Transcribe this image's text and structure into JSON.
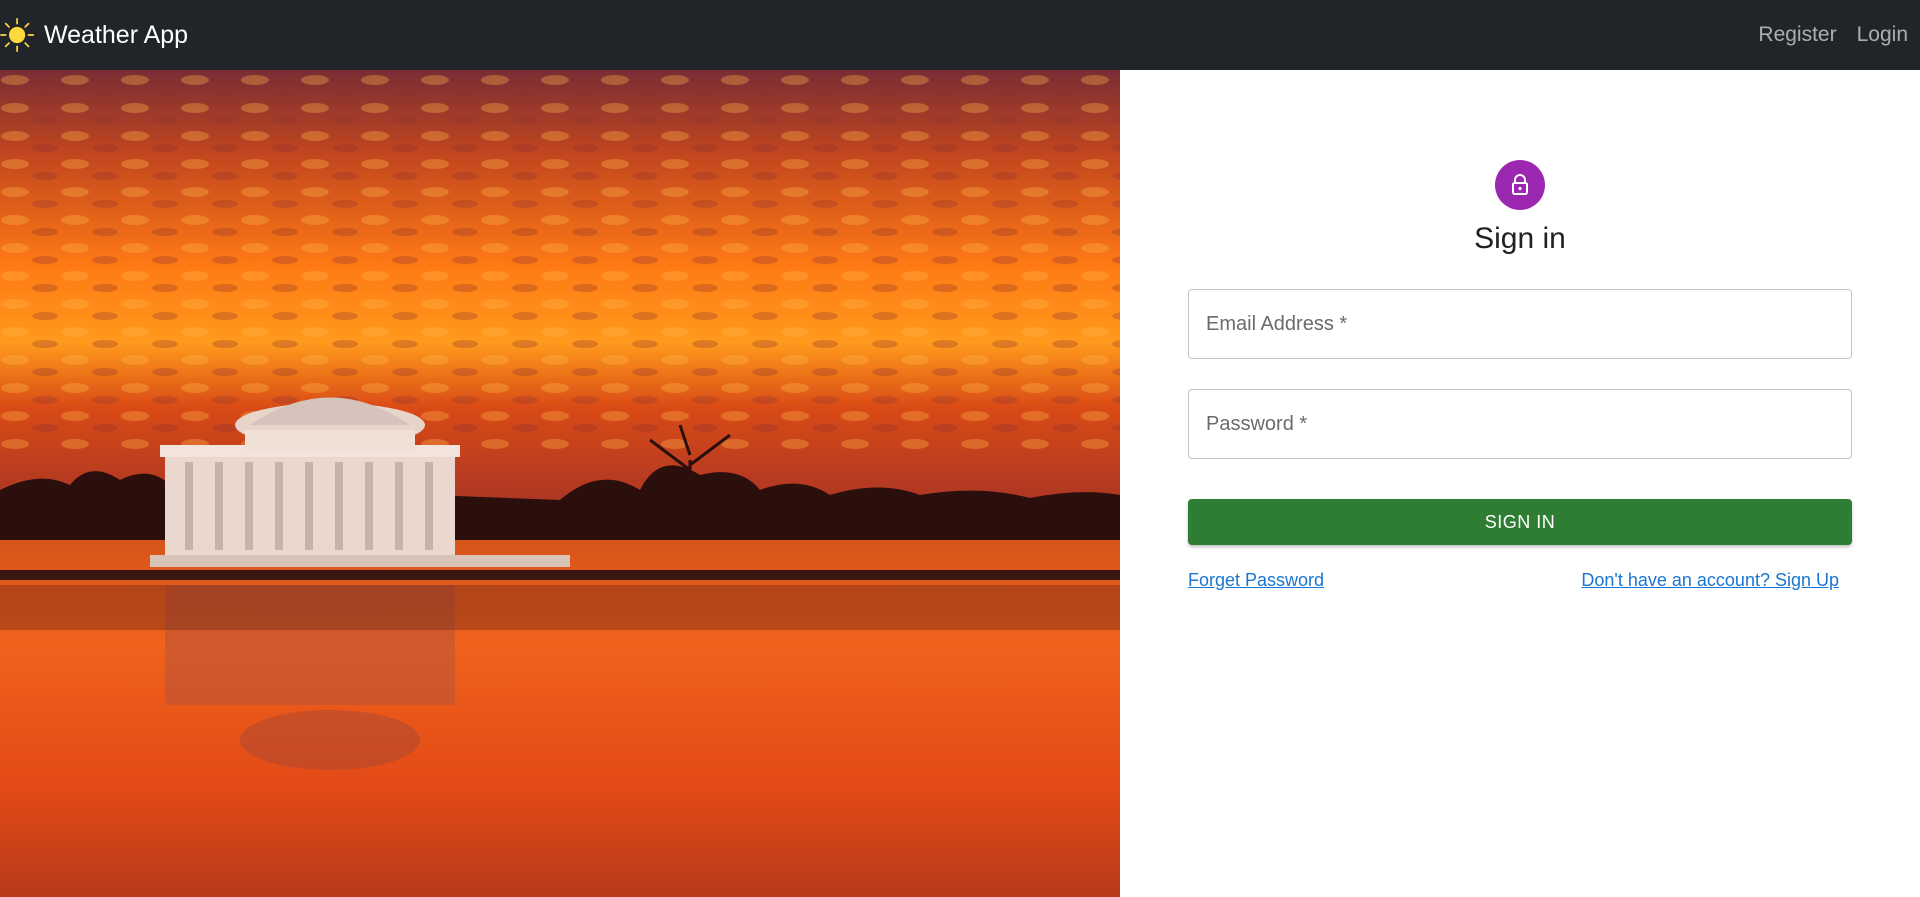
{
  "navbar": {
    "brand": {
      "icon": "sun-icon",
      "title": "Weather App"
    },
    "links": [
      "Register",
      "Login"
    ]
  },
  "hero": {
    "image": "sunset over a domed memorial reflected in water"
  },
  "signin": {
    "icon": "lock-icon",
    "title": "Sign in",
    "email_placeholder": "Email Address *",
    "password_placeholder": "Password *",
    "submit_label": "SIGN IN",
    "forgot_link": "Forget Password",
    "signup_link": "Don't have an account? Sign Up"
  },
  "colors": {
    "navbar_bg": "#212529",
    "accent_purple": "#9c27b0",
    "button_green": "#2e7d32",
    "link_blue": "#1976d2",
    "sun_yellow": "#ffd83d"
  }
}
